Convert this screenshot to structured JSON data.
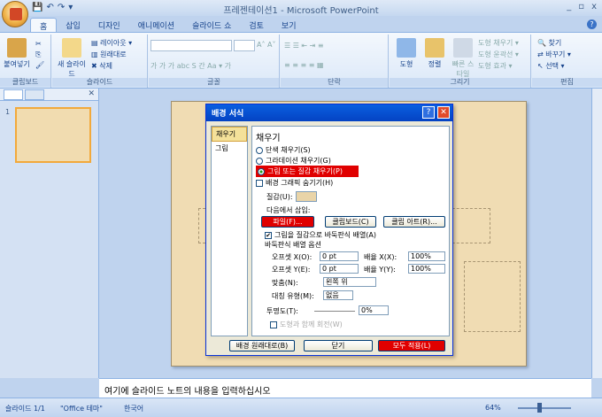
{
  "window": {
    "title": "프레젠테이션1 - Microsoft PowerPoint",
    "controls": [
      "_",
      "▫",
      "x"
    ]
  },
  "qat": [
    "💾",
    "↶",
    "↷",
    "▾"
  ],
  "tabs": [
    "홈",
    "삽입",
    "디자인",
    "애니메이션",
    "슬라이드 쇼",
    "검토",
    "보기"
  ],
  "ribbon": {
    "groups": [
      "클립보드",
      "슬라이드",
      "글꼴",
      "단락",
      "그리기",
      "편집"
    ],
    "paste": "붙여넣기",
    "new_slide": "새\n슬라이드",
    "layout": "레이아웃",
    "reset": "원래대로",
    "delete": "삭제",
    "shape": "도형",
    "arrange": "정렬",
    "quick_styles": "빠른\n스타일",
    "shape_fill": "도형 채우기",
    "shape_outline": "도형 윤곽선",
    "shape_effects": "도형 효과",
    "find": "찾기",
    "replace": "바꾸기",
    "select": "선택"
  },
  "dialog": {
    "title": "배경 서식",
    "categories": [
      "채우기",
      "그림"
    ],
    "section": "채우기",
    "options": [
      "단색 채우기(S)",
      "그라데이션 채우기(G)",
      "그림 또는 질감 채우기(P)"
    ],
    "hide_bg": "배경 그래픽 숨기기(H)",
    "texture_label": "질감(U):",
    "insert_from": "다음에서 삽입:",
    "btn_file": "파일(F)...",
    "btn_clipboard": "클립보드(C)",
    "btn_clipart": "클립 아트(R)...",
    "tile": "그림을 질감으로 바둑판식 배열(A)",
    "tile_options": "바둑판식 배열 옵션",
    "offset_x": "오프셋 X(O):",
    "offset_x_val": "0 pt",
    "offset_y": "오프셋 Y(E):",
    "offset_y_val": "0 pt",
    "scale_x": "배율 X(X):",
    "scale_x_val": "100%",
    "scale_y": "배율 Y(Y):",
    "scale_y_val": "100%",
    "align": "맞춤(N):",
    "align_val": "왼쪽 위",
    "mirror": "대칭 유형(M):",
    "mirror_val": "없음",
    "transparency": "투명도(T):",
    "transparency_val": "0%",
    "rotate": "도형과 함께 회전(W)",
    "btn_reset": "배경 원래대로(B)",
    "btn_close": "닫기",
    "btn_apply_all": "모두 적용(L)"
  },
  "notes": "여기에 슬라이드 노트의 내용을 입력하십시오",
  "status": {
    "slide": "슬라이드 1/1",
    "theme": "\"Office 테마\"",
    "lang": "한국어",
    "zoom": "64%"
  }
}
